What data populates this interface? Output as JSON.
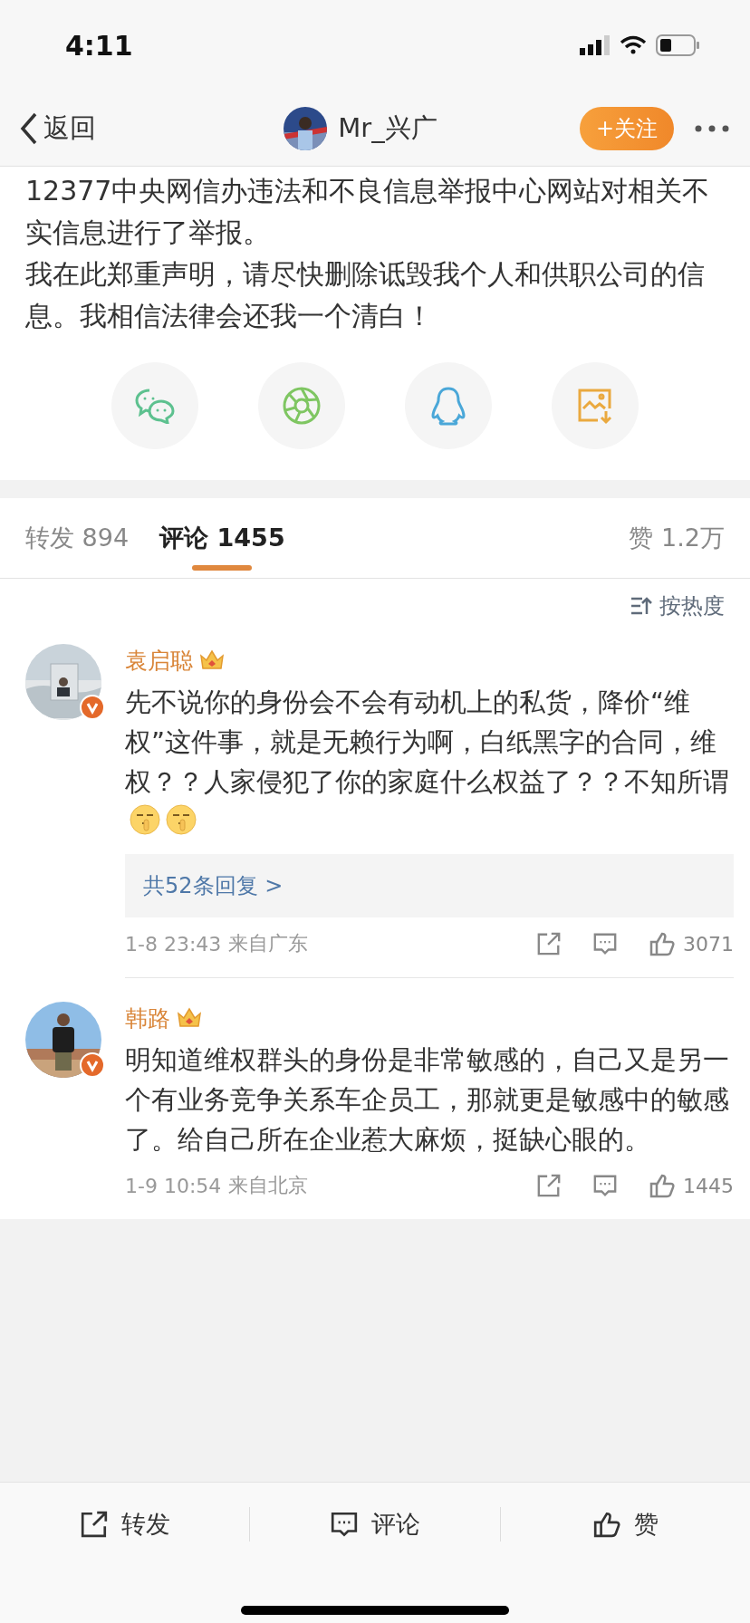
{
  "status_bar": {
    "time": "4:11"
  },
  "nav": {
    "back": "返回",
    "username": "Mr_兴广",
    "follow": "+关注"
  },
  "post": {
    "paragraphs": [
      "12377中央网信办违法和不良信息举报中心网站对相关不实信息进行了举报。",
      "我在此郑重声明，请尽快删除诋毁我个人和供职公司的信息。我相信法律会还我一个清白！"
    ]
  },
  "share": [
    {
      "kind": "wechat"
    },
    {
      "kind": "moments"
    },
    {
      "kind": "qq"
    },
    {
      "kind": "save-image"
    }
  ],
  "tabs": [
    {
      "label": "转发",
      "count": "894",
      "selected": false
    },
    {
      "label": "评论",
      "count": "1455",
      "selected": true
    }
  ],
  "likes": {
    "label": "赞",
    "count": "1.2万"
  },
  "sort": "按热度",
  "comments": [
    {
      "name": "袁启聪",
      "text": "先不说你的身份会不会有动机上的私货，降价“维权”这件事，就是无赖行为啊，白纸黑字的合同，维权？？人家侵犯了你的家庭什么权益了？？不知所谓",
      "emojis": [
        {
          "kind": "shush"
        },
        {
          "kind": "shush"
        }
      ],
      "replies": "共52条回复 >",
      "time": "1-8 23:43",
      "location": "来自广东",
      "likes": "3071"
    },
    {
      "name": "韩路",
      "text": "明知道维权群头的身份是非常敏感的，自己又是另一个有业务竞争关系车企员工，那就更是敏感中的敏感了。给自己所在企业惹大麻烦，挺缺心眼的。",
      "time": "1-9 10:54",
      "location": "来自北京",
      "likes": "1445"
    }
  ],
  "actions": [
    {
      "kind": "repost",
      "label": "转发"
    },
    {
      "kind": "comment",
      "label": "评论"
    },
    {
      "kind": "like",
      "label": "赞"
    }
  ]
}
